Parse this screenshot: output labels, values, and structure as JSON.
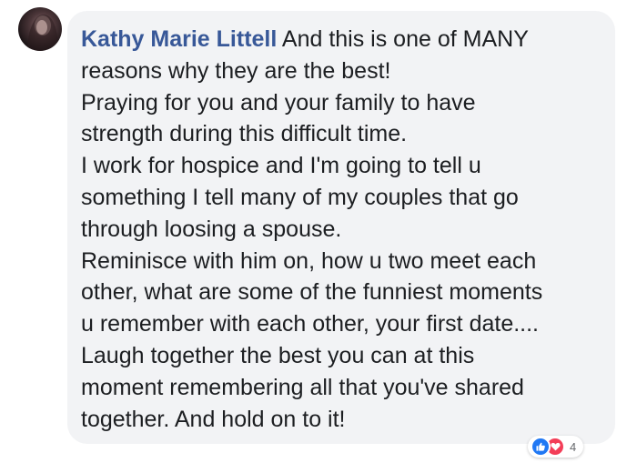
{
  "comment": {
    "author": "Kathy Marie Littell",
    "first_line_text": "And this is one of MANY",
    "lines": [
      "reasons why they are the best!",
      "Praying for you and your family to have",
      "strength during this difficult time.",
      "I work for hospice and I'm going to tell u",
      "something I tell many of my couples that go",
      "through loosing a spouse.",
      "Reminisce with him on, how u two meet each",
      "other, what are some of the funniest moments",
      "u remember with each other, your first date....",
      "Laugh together the best you can at this",
      "moment remembering all that you've shared",
      "together. And hold on to it!"
    ]
  },
  "reactions": {
    "icons": [
      "like-icon",
      "love-icon"
    ],
    "count": "4"
  },
  "colors": {
    "author": "#385898",
    "bubble": "#f2f3f5",
    "text": "#1c1e21",
    "like": "#2078f4",
    "love": "#f33e58"
  }
}
